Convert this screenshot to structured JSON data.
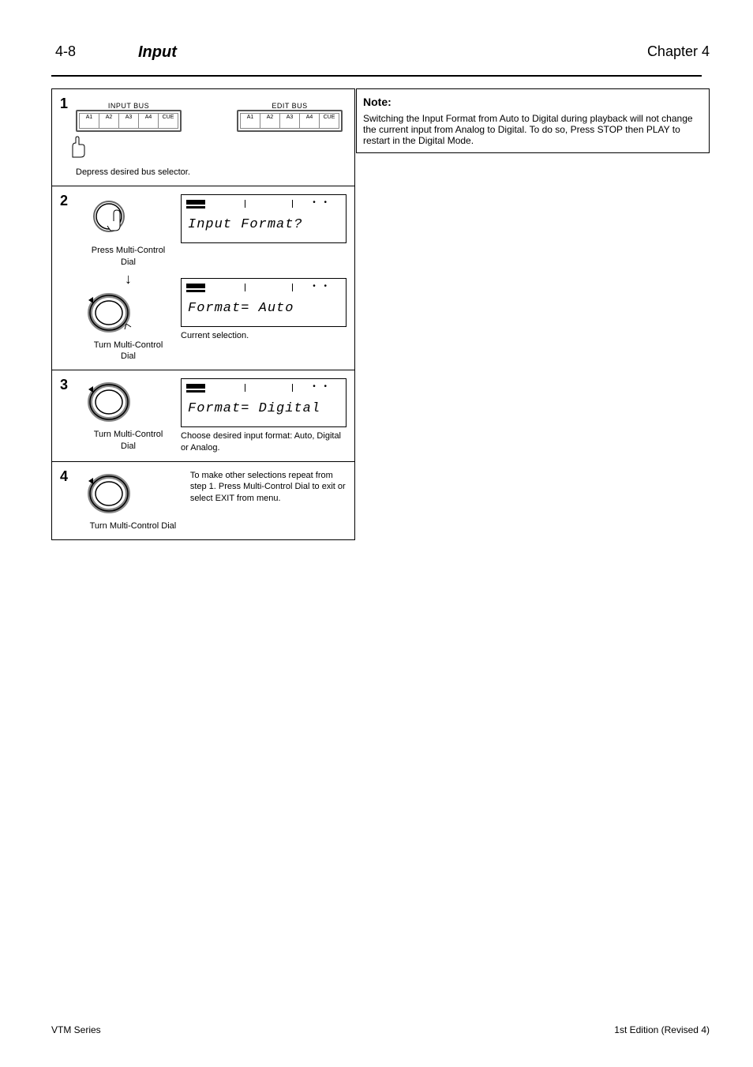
{
  "header": {
    "page_number": "4-8",
    "title": "Input",
    "chapter": "Chapter 4"
  },
  "note": {
    "heading": "Note:",
    "body": "Switching the Input Format from Auto to Digital during playback will not change the current input from Analog to Digital. To do so, Press STOP then PLAY to restart in the Digital Mode."
  },
  "steps": [
    {
      "number": "1",
      "left_caption": "Depress desired bus selector.",
      "btn_group_labels": [
        "INPUT BUS",
        "EDIT BUS"
      ],
      "btn_cells_a": [
        "A1",
        "A2",
        "A3",
        "A4",
        "CUE"
      ],
      "btn_cells_b": [
        "A1",
        "A2",
        "A3",
        "A4",
        "CUE"
      ]
    },
    {
      "number": "2",
      "press_caption": "Press Multi-Control Dial",
      "turn_caption": "Turn Multi-Control Dial",
      "lcd1": "Input Format?",
      "lcd2": "Format= Auto",
      "lcd2_caption": "Current selection."
    },
    {
      "number": "3",
      "turn_caption": "Turn Multi-Control Dial",
      "lcd": "Format= Digital",
      "lcd_caption": "Choose desired input format: Auto, Digital or Analog."
    },
    {
      "number": "4",
      "turn_caption": "Turn Multi-Control Dial",
      "right_caption": "To make other selections repeat from step 1. Press Multi-Control Dial to exit or select EXIT from menu."
    }
  ],
  "footer": {
    "model": "VTM Series",
    "revision": "1st Edition (Revised 4)"
  }
}
